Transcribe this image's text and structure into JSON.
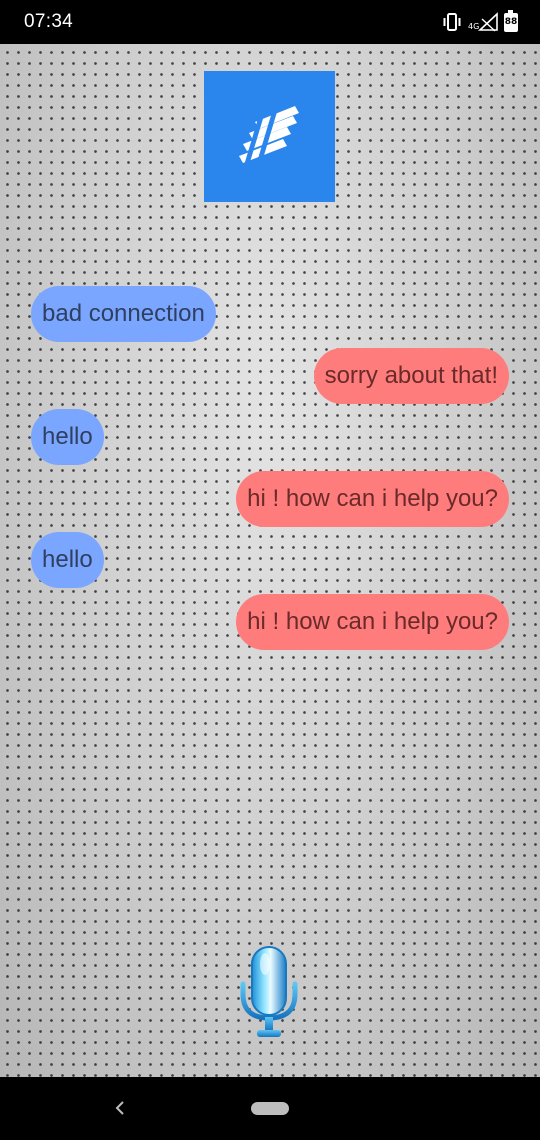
{
  "status_bar": {
    "time": "07:34",
    "network_label": "4G",
    "battery_level": "88",
    "icons": [
      "vibrate-icon",
      "signal-icon",
      "battery-icon"
    ]
  },
  "header": {
    "logo_icon": "app-logo-icon",
    "logo_color": "#2a85ec"
  },
  "messages": [
    {
      "sender": "user",
      "text": "bad connection"
    },
    {
      "sender": "bot",
      "text": "sorry about that!"
    },
    {
      "sender": "user",
      "text": "hello"
    },
    {
      "sender": "bot",
      "text": "hi ! how can i help you?"
    },
    {
      "sender": "user",
      "text": "hello"
    },
    {
      "sender": "bot",
      "text": "hi ! how can i help you?"
    }
  ],
  "colors": {
    "user_bubble": "#7aa6ff",
    "bot_bubble": "#ff7c7c"
  },
  "mic_button": {
    "icon": "microphone-icon"
  },
  "nav_bar": {
    "icons": [
      "back-icon",
      "home-pill-icon"
    ]
  }
}
